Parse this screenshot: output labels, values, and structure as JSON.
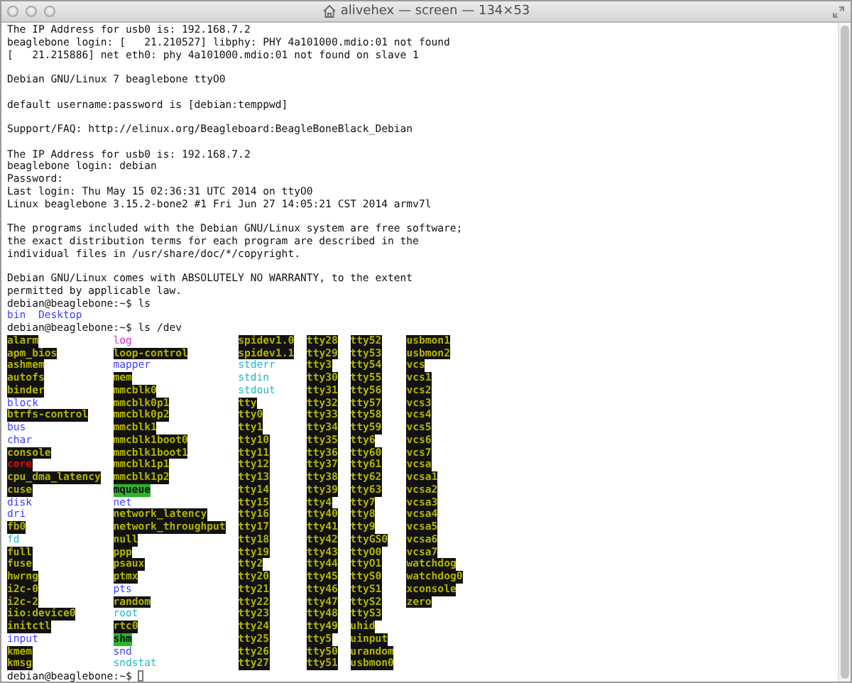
{
  "window": {
    "title": "alivehex — screen — 134×53"
  },
  "terminal": {
    "items": [
      {
        "kind": "text",
        "text": "The IP Address for usb0 is: 192.168.7.2"
      },
      {
        "kind": "text",
        "text": "beaglebone login: [   21.210527] libphy: PHY 4a101000.mdio:01 not found"
      },
      {
        "kind": "text",
        "text": "[   21.215886] net eth0: phy 4a101000.mdio:01 not found on slave 1"
      },
      {
        "kind": "blank"
      },
      {
        "kind": "text",
        "text": "Debian GNU/Linux 7 beaglebone ttyO0"
      },
      {
        "kind": "blank"
      },
      {
        "kind": "text",
        "text": "default username:password is [debian:temppwd]"
      },
      {
        "kind": "blank"
      },
      {
        "kind": "text",
        "text": "Support/FAQ: http://elinux.org/Beagleboard:BeagleBoneBlack_Debian"
      },
      {
        "kind": "blank"
      },
      {
        "kind": "text",
        "text": "The IP Address for usb0 is: 192.168.7.2"
      },
      {
        "kind": "text",
        "text": "beaglebone login: debian"
      },
      {
        "kind": "text",
        "text": "Password:"
      },
      {
        "kind": "text",
        "text": "Last login: Thu May 15 02:36:31 UTC 2014 on ttyO0"
      },
      {
        "kind": "text",
        "text": "Linux beaglebone 3.15.2-bone2 #1 Fri Jun 27 14:05:21 CST 2014 armv7l"
      },
      {
        "kind": "blank"
      },
      {
        "kind": "text",
        "text": "The programs included with the Debian GNU/Linux system are free software;"
      },
      {
        "kind": "text",
        "text": "the exact distribution terms for each program are described in the"
      },
      {
        "kind": "text",
        "text": "individual files in /usr/share/doc/*/copyright."
      },
      {
        "kind": "blank"
      },
      {
        "kind": "text",
        "text": "Debian GNU/Linux comes with ABSOLUTELY NO WARRANTY, to the extent"
      },
      {
        "kind": "text",
        "text": "permitted by applicable law."
      },
      {
        "kind": "prompt",
        "text": "debian@beaglebone:~$ ls",
        "cursor": false
      },
      {
        "kind": "listing",
        "columns": [
          [
            {
              "name": "bin",
              "kind": "dir"
            }
          ],
          [
            {
              "name": "Desktop",
              "kind": "dir"
            }
          ]
        ]
      },
      {
        "kind": "prompt",
        "text": "debian@beaglebone:~$ ls /dev",
        "cursor": false
      },
      {
        "kind": "listing",
        "columns": [
          [
            {
              "name": "alarm",
              "kind": "device"
            },
            {
              "name": "apm_bios",
              "kind": "device"
            },
            {
              "name": "ashmem",
              "kind": "device"
            },
            {
              "name": "autofs",
              "kind": "device"
            },
            {
              "name": "binder",
              "kind": "device"
            },
            {
              "name": "block",
              "kind": "dir"
            },
            {
              "name": "btrfs-control",
              "kind": "device"
            },
            {
              "name": "bus",
              "kind": "dir"
            },
            {
              "name": "char",
              "kind": "dir"
            },
            {
              "name": "console",
              "kind": "device"
            },
            {
              "name": "core",
              "kind": "broken"
            },
            {
              "name": "cpu_dma_latency",
              "kind": "device"
            },
            {
              "name": "cuse",
              "kind": "device"
            },
            {
              "name": "disk",
              "kind": "dir"
            },
            {
              "name": "dri",
              "kind": "dir"
            },
            {
              "name": "fb0",
              "kind": "device"
            },
            {
              "name": "fd",
              "kind": "link"
            },
            {
              "name": "full",
              "kind": "device"
            },
            {
              "name": "fuse",
              "kind": "device"
            },
            {
              "name": "hwrng",
              "kind": "device"
            },
            {
              "name": "i2c-0",
              "kind": "device"
            },
            {
              "name": "i2c-2",
              "kind": "device"
            },
            {
              "name": "iio:device0",
              "kind": "device"
            },
            {
              "name": "initctl",
              "kind": "device"
            },
            {
              "name": "input",
              "kind": "dir"
            },
            {
              "name": "kmem",
              "kind": "device"
            },
            {
              "name": "kmsg",
              "kind": "device"
            }
          ],
          [
            {
              "name": "log",
              "kind": "socket"
            },
            {
              "name": "loop-control",
              "kind": "device"
            },
            {
              "name": "mapper",
              "kind": "dir"
            },
            {
              "name": "mem",
              "kind": "device"
            },
            {
              "name": "mmcblk0",
              "kind": "device"
            },
            {
              "name": "mmcblk0p1",
              "kind": "device"
            },
            {
              "name": "mmcblk0p2",
              "kind": "device"
            },
            {
              "name": "mmcblk1",
              "kind": "device"
            },
            {
              "name": "mmcblk1boot0",
              "kind": "device"
            },
            {
              "name": "mmcblk1boot1",
              "kind": "device"
            },
            {
              "name": "mmcblk1p1",
              "kind": "device"
            },
            {
              "name": "mmcblk1p2",
              "kind": "device"
            },
            {
              "name": "mqueue",
              "kind": "sticky"
            },
            {
              "name": "net",
              "kind": "dir"
            },
            {
              "name": "network_latency",
              "kind": "device"
            },
            {
              "name": "network_throughput",
              "kind": "device"
            },
            {
              "name": "null",
              "kind": "device"
            },
            {
              "name": "ppp",
              "kind": "device"
            },
            {
              "name": "psaux",
              "kind": "device"
            },
            {
              "name": "ptmx",
              "kind": "device"
            },
            {
              "name": "pts",
              "kind": "dir"
            },
            {
              "name": "random",
              "kind": "device"
            },
            {
              "name": "root",
              "kind": "link"
            },
            {
              "name": "rtc0",
              "kind": "device"
            },
            {
              "name": "shm",
              "kind": "sticky"
            },
            {
              "name": "snd",
              "kind": "dir"
            },
            {
              "name": "sndstat",
              "kind": "link"
            }
          ],
          [
            {
              "name": "spidev1.0",
              "kind": "device"
            },
            {
              "name": "spidev1.1",
              "kind": "device"
            },
            {
              "name": "stderr",
              "kind": "link"
            },
            {
              "name": "stdin",
              "kind": "link"
            },
            {
              "name": "stdout",
              "kind": "link"
            },
            {
              "name": "tty",
              "kind": "device"
            },
            {
              "name": "tty0",
              "kind": "device"
            },
            {
              "name": "tty1",
              "kind": "device"
            },
            {
              "name": "tty10",
              "kind": "device"
            },
            {
              "name": "tty11",
              "kind": "device"
            },
            {
              "name": "tty12",
              "kind": "device"
            },
            {
              "name": "tty13",
              "kind": "device"
            },
            {
              "name": "tty14",
              "kind": "device"
            },
            {
              "name": "tty15",
              "kind": "device"
            },
            {
              "name": "tty16",
              "kind": "device"
            },
            {
              "name": "tty17",
              "kind": "device"
            },
            {
              "name": "tty18",
              "kind": "device"
            },
            {
              "name": "tty19",
              "kind": "device"
            },
            {
              "name": "tty2",
              "kind": "device"
            },
            {
              "name": "tty20",
              "kind": "device"
            },
            {
              "name": "tty21",
              "kind": "device"
            },
            {
              "name": "tty22",
              "kind": "device"
            },
            {
              "name": "tty23",
              "kind": "device"
            },
            {
              "name": "tty24",
              "kind": "device"
            },
            {
              "name": "tty25",
              "kind": "device"
            },
            {
              "name": "tty26",
              "kind": "device"
            },
            {
              "name": "tty27",
              "kind": "device"
            }
          ],
          [
            {
              "name": "tty28",
              "kind": "device"
            },
            {
              "name": "tty29",
              "kind": "device"
            },
            {
              "name": "tty3",
              "kind": "device"
            },
            {
              "name": "tty30",
              "kind": "device"
            },
            {
              "name": "tty31",
              "kind": "device"
            },
            {
              "name": "tty32",
              "kind": "device"
            },
            {
              "name": "tty33",
              "kind": "device"
            },
            {
              "name": "tty34",
              "kind": "device"
            },
            {
              "name": "tty35",
              "kind": "device"
            },
            {
              "name": "tty36",
              "kind": "device"
            },
            {
              "name": "tty37",
              "kind": "device"
            },
            {
              "name": "tty38",
              "kind": "device"
            },
            {
              "name": "tty39",
              "kind": "device"
            },
            {
              "name": "tty4",
              "kind": "device"
            },
            {
              "name": "tty40",
              "kind": "device"
            },
            {
              "name": "tty41",
              "kind": "device"
            },
            {
              "name": "tty42",
              "kind": "device"
            },
            {
              "name": "tty43",
              "kind": "device"
            },
            {
              "name": "tty44",
              "kind": "device"
            },
            {
              "name": "tty45",
              "kind": "device"
            },
            {
              "name": "tty46",
              "kind": "device"
            },
            {
              "name": "tty47",
              "kind": "device"
            },
            {
              "name": "tty48",
              "kind": "device"
            },
            {
              "name": "tty49",
              "kind": "device"
            },
            {
              "name": "tty5",
              "kind": "device"
            },
            {
              "name": "tty50",
              "kind": "device"
            },
            {
              "name": "tty51",
              "kind": "device"
            }
          ],
          [
            {
              "name": "tty52",
              "kind": "device"
            },
            {
              "name": "tty53",
              "kind": "device"
            },
            {
              "name": "tty54",
              "kind": "device"
            },
            {
              "name": "tty55",
              "kind": "device"
            },
            {
              "name": "tty56",
              "kind": "device"
            },
            {
              "name": "tty57",
              "kind": "device"
            },
            {
              "name": "tty58",
              "kind": "device"
            },
            {
              "name": "tty59",
              "kind": "device"
            },
            {
              "name": "tty6",
              "kind": "device"
            },
            {
              "name": "tty60",
              "kind": "device"
            },
            {
              "name": "tty61",
              "kind": "device"
            },
            {
              "name": "tty62",
              "kind": "device"
            },
            {
              "name": "tty63",
              "kind": "device"
            },
            {
              "name": "tty7",
              "kind": "device"
            },
            {
              "name": "tty8",
              "kind": "device"
            },
            {
              "name": "tty9",
              "kind": "device"
            },
            {
              "name": "ttyGS0",
              "kind": "device"
            },
            {
              "name": "ttyO0",
              "kind": "device"
            },
            {
              "name": "ttyO1",
              "kind": "device"
            },
            {
              "name": "ttyS0",
              "kind": "device"
            },
            {
              "name": "ttyS1",
              "kind": "device"
            },
            {
              "name": "ttyS2",
              "kind": "device"
            },
            {
              "name": "ttyS3",
              "kind": "device"
            },
            {
              "name": "uhid",
              "kind": "device"
            },
            {
              "name": "uinput",
              "kind": "device"
            },
            {
              "name": "urandom",
              "kind": "device"
            },
            {
              "name": "usbmon0",
              "kind": "device"
            }
          ],
          [
            {
              "name": "usbmon1",
              "kind": "device"
            },
            {
              "name": "usbmon2",
              "kind": "device"
            },
            {
              "name": "vcs",
              "kind": "device"
            },
            {
              "name": "vcs1",
              "kind": "device"
            },
            {
              "name": "vcs2",
              "kind": "device"
            },
            {
              "name": "vcs3",
              "kind": "device"
            },
            {
              "name": "vcs4",
              "kind": "device"
            },
            {
              "name": "vcs5",
              "kind": "device"
            },
            {
              "name": "vcs6",
              "kind": "device"
            },
            {
              "name": "vcs7",
              "kind": "device"
            },
            {
              "name": "vcsa",
              "kind": "device"
            },
            {
              "name": "vcsa1",
              "kind": "device"
            },
            {
              "name": "vcsa2",
              "kind": "device"
            },
            {
              "name": "vcsa3",
              "kind": "device"
            },
            {
              "name": "vcsa4",
              "kind": "device"
            },
            {
              "name": "vcsa5",
              "kind": "device"
            },
            {
              "name": "vcsa6",
              "kind": "device"
            },
            {
              "name": "vcsa7",
              "kind": "device"
            },
            {
              "name": "watchdog",
              "kind": "device"
            },
            {
              "name": "watchdog0",
              "kind": "device"
            },
            {
              "name": "xconsole",
              "kind": "device"
            },
            {
              "name": "zero",
              "kind": "device"
            }
          ]
        ]
      },
      {
        "kind": "prompt",
        "text": "debian@beaglebone:~$",
        "cursor": true
      }
    ]
  }
}
